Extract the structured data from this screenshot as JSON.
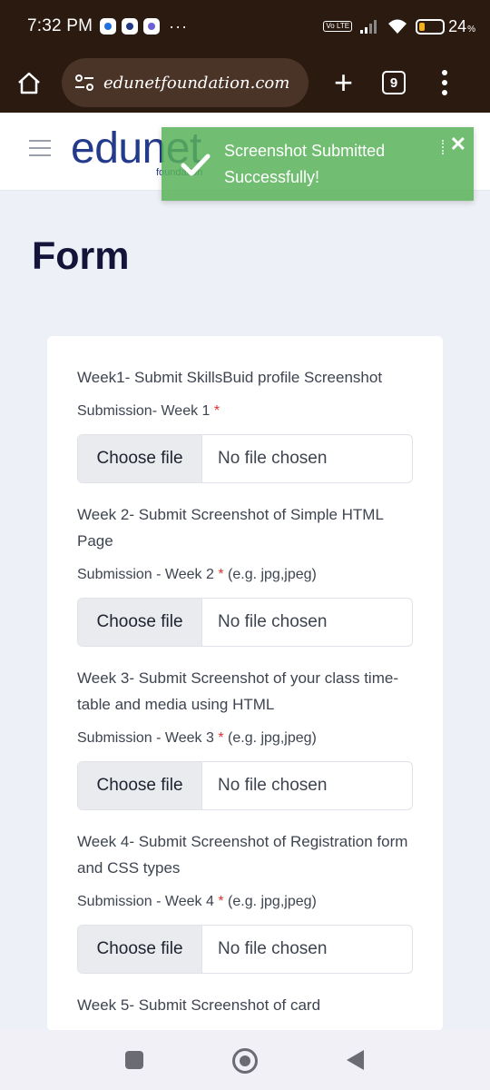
{
  "status_bar": {
    "time": "7:32 PM",
    "more": "···",
    "volte": "Vo LTE",
    "battery_percent": "24",
    "battery_level": 0.24,
    "accent_battery": "#f2b21c"
  },
  "browser": {
    "url": "edunetfoundation.com",
    "tab_count": "9",
    "icons": [
      "home-icon",
      "site-settings-icon",
      "new-tab-icon",
      "tabs-icon",
      "more-menu-icon"
    ]
  },
  "site": {
    "logo_text": "edunet",
    "logo_sub": "foundation",
    "brand_color": "#243a8a"
  },
  "toast": {
    "line1": "Screenshot Submitted",
    "line2": "Successfully!",
    "close": "✕",
    "color": "#58b258"
  },
  "page": {
    "title": "Form"
  },
  "form": {
    "sections": [
      {
        "description": "Week1- Submit SkillsBuid profile Screenshot",
        "label": "Submission- Week 1",
        "required": "*",
        "hint": "",
        "button": "Choose file",
        "status": "No file chosen"
      },
      {
        "description": "Week 2- Submit Screenshot of Simple HTML Page",
        "label": "Submission - Week 2",
        "required": "*",
        "hint": "(e.g. jpg,jpeg)",
        "button": "Choose file",
        "status": "No file chosen"
      },
      {
        "description": "Week 3- Submit Screenshot of your class time-table and media using HTML",
        "label": "Submission - Week 3",
        "required": "*",
        "hint": "(e.g. jpg,jpeg)",
        "button": "Choose file",
        "status": "No file chosen"
      },
      {
        "description": "Week 4- Submit Screenshot of Registration form and CSS types",
        "label": "Submission - Week 4",
        "required": "*",
        "hint": "(e.g. jpg,jpeg)",
        "button": "Choose file",
        "status": "No file chosen"
      },
      {
        "description": "Week 5- Submit Screenshot of card"
      }
    ]
  },
  "nav": {
    "icons": [
      "recents-icon",
      "home-icon",
      "back-icon"
    ]
  }
}
